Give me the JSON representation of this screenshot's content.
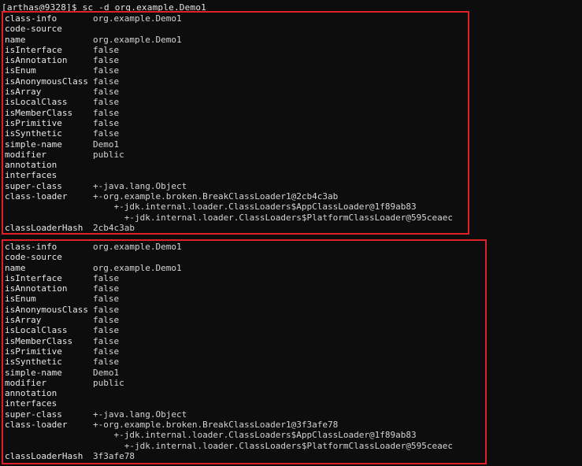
{
  "terminal": {
    "background_color": "#0d0d0d",
    "foreground_color": "#d8d8d8",
    "highlight_color": "#e01f26",
    "prompt": "[arthas@9328]$ sc -d org.example.Demo1"
  },
  "blocks": [
    {
      "id": "class-detail-1",
      "highlighted": true,
      "rows": [
        {
          "key": "class-info",
          "value": "org.example.Demo1"
        },
        {
          "key": "code-source",
          "value": ""
        },
        {
          "key": "name",
          "value": "org.example.Demo1"
        },
        {
          "key": "isInterface",
          "value": "false"
        },
        {
          "key": "isAnnotation",
          "value": "false"
        },
        {
          "key": "isEnum",
          "value": "false"
        },
        {
          "key": "isAnonymousClass",
          "value": "false"
        },
        {
          "key": "isArray",
          "value": "false"
        },
        {
          "key": "isLocalClass",
          "value": "false"
        },
        {
          "key": "isMemberClass",
          "value": "false"
        },
        {
          "key": "isPrimitive",
          "value": "false"
        },
        {
          "key": "isSynthetic",
          "value": "false"
        },
        {
          "key": "simple-name",
          "value": "Demo1"
        },
        {
          "key": "modifier",
          "value": "public"
        },
        {
          "key": "annotation",
          "value": ""
        },
        {
          "key": "interfaces",
          "value": ""
        },
        {
          "key": "super-class",
          "value": "+-java.lang.Object"
        },
        {
          "key": "class-loader",
          "value": "+-org.example.broken.BreakClassLoader1@2cb4c3ab"
        },
        {
          "key": "",
          "value": "    +-jdk.internal.loader.ClassLoaders$AppClassLoader@1f89ab83"
        },
        {
          "key": "",
          "value": "      +-jdk.internal.loader.ClassLoaders$PlatformClassLoader@595ceaec"
        },
        {
          "key": "classLoaderHash",
          "value": "2cb4c3ab"
        }
      ]
    },
    {
      "id": "class-detail-2",
      "highlighted": true,
      "rows": [
        {
          "key": "class-info",
          "value": "org.example.Demo1"
        },
        {
          "key": "code-source",
          "value": ""
        },
        {
          "key": "name",
          "value": "org.example.Demo1"
        },
        {
          "key": "isInterface",
          "value": "false"
        },
        {
          "key": "isAnnotation",
          "value": "false"
        },
        {
          "key": "isEnum",
          "value": "false"
        },
        {
          "key": "isAnonymousClass",
          "value": "false"
        },
        {
          "key": "isArray",
          "value": "false"
        },
        {
          "key": "isLocalClass",
          "value": "false"
        },
        {
          "key": "isMemberClass",
          "value": "false"
        },
        {
          "key": "isPrimitive",
          "value": "false"
        },
        {
          "key": "isSynthetic",
          "value": "false"
        },
        {
          "key": "simple-name",
          "value": "Demo1"
        },
        {
          "key": "modifier",
          "value": "public"
        },
        {
          "key": "annotation",
          "value": ""
        },
        {
          "key": "interfaces",
          "value": ""
        },
        {
          "key": "super-class",
          "value": "+-java.lang.Object"
        },
        {
          "key": "class-loader",
          "value": "+-org.example.broken.BreakClassLoader1@3f3afe78"
        },
        {
          "key": "",
          "value": "    +-jdk.internal.loader.ClassLoaders$AppClassLoader@1f89ab83"
        },
        {
          "key": "",
          "value": "      +-jdk.internal.loader.ClassLoaders$PlatformClassLoader@595ceaec"
        },
        {
          "key": "classLoaderHash",
          "value": "3f3afe78"
        }
      ]
    }
  ]
}
